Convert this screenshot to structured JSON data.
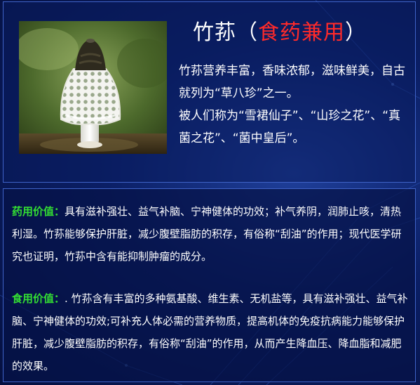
{
  "header": {
    "title_main": "竹荪",
    "title_paren_open": "（",
    "title_highlight": "食药兼用",
    "title_paren_close": "）"
  },
  "intro": {
    "line1": "竹荪营养丰富，香味浓郁，滋味鲜美，自古就列为“草八珍”之一。",
    "line2": "被人们称为“雪裙仙子”、“山珍之花”、“真菌之花”、“菌中皇后”。"
  },
  "medicinal": {
    "label": "药用价值：",
    "text": "具有滋补强壮、益气补脑、宁神健体的功效；补气养阴，润肺止咳，清热利湿。竹荪能够保护肝脏，减少腹壁脂肪的积存，有俗称“刮油”的作用；现代医学研究也证明，竹荪中含有能抑制肿瘤的成分。"
  },
  "edible": {
    "label": "食用价值：",
    "text": ". 竹荪含有丰富的多种氨基酸、维生素、无机盐等，具有滋补强壮、益气补脑、宁神健体的功效;可补充人体必需的营养物质，提高机体的免疫抗病能力能够保护肝脏，减少腹壁脂肪的积存，有俗称“刮油”的作用，从而产生降血压、降血脂和减肥的效果。"
  },
  "colors": {
    "background": "#0b1f66",
    "panel_border": "#3f63c8",
    "title_highlight": "#ff2a2a",
    "label_green": "#33dd33",
    "text": "#ffffff"
  },
  "icons": {
    "photo": "bamboo-fungus-photo"
  }
}
